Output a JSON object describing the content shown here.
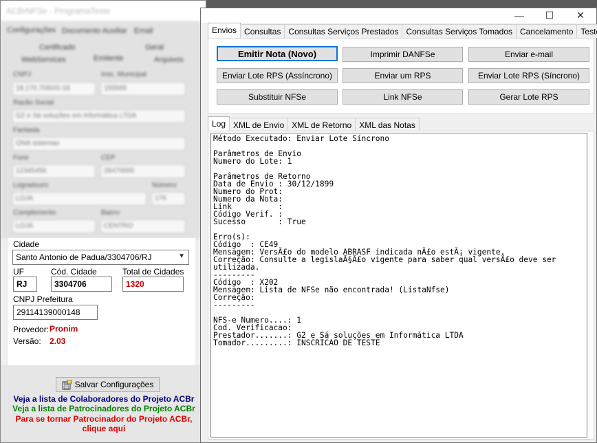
{
  "back_window": {
    "title": "ACBrNFSe - ProgramaTeste",
    "top_tabs": [
      "Configurações",
      "Documento Auxiliar",
      "Email"
    ],
    "sub_tabs_row1": [
      "Certificado",
      "Geral"
    ],
    "sub_tabs_row2": [
      "WebServices",
      "Emitente",
      "Arquivos"
    ],
    "blur_labels": [
      "CNPJ",
      "Insc. Municipal",
      "Razão Social",
      "Fantasia",
      "Fone",
      "CEP",
      "Logradouro",
      "Número",
      "Complemento",
      "Bairro"
    ],
    "blur_values": [
      "18.170.7060/0-18",
      "155565",
      "G2 e Sá soluções em Informática LTDA",
      "ONA sistemas",
      "12345456",
      "28470000",
      "LOJA",
      "176",
      "LOJA",
      "CENTRO"
    ],
    "cidade_label": "Cidade",
    "cidade_value": "Santo Antonio de Padua/3304706/RJ",
    "uf_label": "UF",
    "uf_value": "RJ",
    "cod_cidade_label": "Cód. Cidade",
    "cod_cidade_value": "3304706",
    "total_cidades_label": "Total de Cidades",
    "total_cidades_value": "1320",
    "cnpj_prefeitura_label": "CNPJ Prefeitura",
    "cnpj_prefeitura_value": "29114139000148",
    "provedor_label": "Provedor:",
    "provedor_value": "Pronim",
    "versao_label": "Versão:",
    "versao_value": "2.03",
    "save_button_label": "Salvar Configurações",
    "links": {
      "colaboradores": "Veja a lista de Colaboradores do Projeto ACBr",
      "patrocinadores": "Veja a lista de Patrocinadores do Projeto ACBr",
      "tornar_patrocinador_1": "Para se tornar Patrocinador do Projeto ACBr,",
      "tornar_patrocinador_2": "clique aqui"
    },
    "colors": {
      "blue_link": "#000080",
      "green_link": "#008000",
      "red_link": "#e00000",
      "red_value": "#c00000"
    }
  },
  "front_window": {
    "controls": {
      "minimize": "—",
      "maximize": "☐",
      "close": "✕"
    },
    "main_tabs": [
      "Envios",
      "Consultas",
      "Consultas Serviços Prestados",
      "Consultas Serviços Tomados",
      "Cancelamento",
      "Teste"
    ],
    "active_main_tab": "Envios",
    "buttons": {
      "emitir": "Emitir Nota (Novo)",
      "imprimir": "Imprimir DANFSe",
      "email": "Enviar e-mail",
      "lote_async": "Enviar Lote RPS (Assíncrono)",
      "enviar_um": "Enviar um RPS",
      "lote_sync": "Enviar Lote RPS (Síncrono)",
      "substituir": "Substituir NFSe",
      "link": "Link NFSe",
      "gerar": "Gerar Lote RPS"
    },
    "log_tabs": [
      "Log",
      "XML de Envio",
      "XML de Retorno",
      "XML das Notas"
    ],
    "active_log_tab": "Log",
    "log_lines": [
      "Método Executado: Enviar Lote Síncrono",
      "",
      "Parâmetros de Envio",
      "Numero do Lote: 1",
      "",
      "Parâmetros de Retorno",
      "Data de Envio : 30/12/1899",
      "Numero do Prot:",
      "Numero da Nota:",
      "Link          :",
      "Código Verif. :",
      "Sucesso       : True",
      "",
      "Erro(s):",
      "Código  : CE49",
      "Mensagem: VersÃ£o do modelo ABRASF indicada nÃ£o estÃ¡ vigente.",
      "Correção: Consulte a legislaÃ§Ã£o vigente para saber qual versÃ£o deve ser",
      "utilizada.",
      "---------",
      "Código  : X202",
      "Mensagem: Lista de NFSe não encontrada! (ListaNfse)",
      "Correção:",
      "---------",
      "",
      "NFS-e Numero....: 1",
      "Cod. Verificacao:",
      "Prestador.......: G2 e Sá soluções em Informática LTDA",
      "Tomador.........: INSCRICAO DE TESTE"
    ]
  }
}
